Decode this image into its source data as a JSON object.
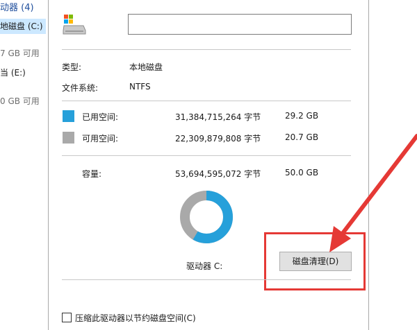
{
  "left_pane": {
    "header": "动器 (4)",
    "drive_c": "地磁盘 (C:)",
    "drive_c_free": "7 GB 可用",
    "drive_e": "当 (E:)",
    "drive_e_free": "0 GB 可用"
  },
  "dialog": {
    "name_value": "",
    "type_label": "类型:",
    "type_value": "本地磁盘",
    "fs_label": "文件系统:",
    "fs_value": "NTFS",
    "used_label": "已用空间:",
    "used_bytes": "31,384,715,264 字节",
    "used_size": "29.2 GB",
    "free_label": "可用空间:",
    "free_bytes": "22,309,879,808 字节",
    "free_size": "20.7 GB",
    "capacity_label": "容量:",
    "capacity_bytes": "53,694,595,072 字节",
    "capacity_size": "50.0 GB",
    "drive_label": "驱动器 C:",
    "cleanup_button": "磁盘清理(D)",
    "compress_label": "压缩此驱动器以节约磁盘空间(C)",
    "colors": {
      "used": "#26a0da",
      "free": "#a9a9a9",
      "annotation": "#e53935"
    },
    "usage_fraction": 0.5845
  }
}
